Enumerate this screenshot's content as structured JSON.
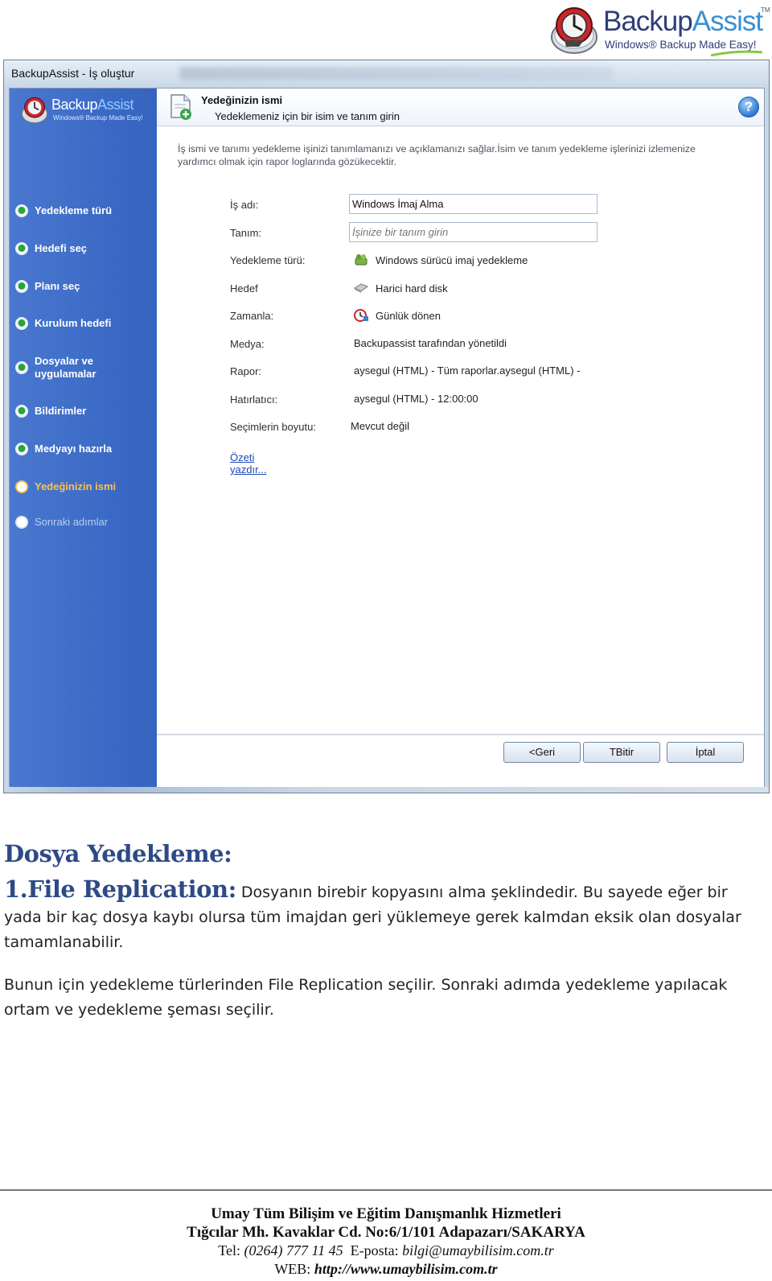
{
  "logo": {
    "brand_part1": "Backup",
    "brand_part2": "Assist",
    "tm": "TM",
    "tagline": "Windows® Backup Made Easy!"
  },
  "window": {
    "title": "BackupAssist - İş oluştur",
    "sidebar_logo": {
      "brand_part1": "Backup",
      "brand_part2": "Assist",
      "tagline": "Windows® Backup Made Easy!"
    },
    "steps": [
      {
        "label": "Yedekleme türü",
        "state": "done"
      },
      {
        "label": "Hedefi seç",
        "state": "done"
      },
      {
        "label": "Planı seç",
        "state": "done"
      },
      {
        "label": "Kurulum hedefi",
        "state": "done"
      },
      {
        "label": "Dosyalar ve uygulamalar",
        "state": "done"
      },
      {
        "label": "Bildirimler",
        "state": "done"
      },
      {
        "label": "Medyayı hazırla",
        "state": "done"
      },
      {
        "label": "Yedeğinizin ismi",
        "state": "current"
      },
      {
        "label": "Sonraki adımlar",
        "state": "future"
      }
    ],
    "header": {
      "title": "Yedeğinizin ismi",
      "subtitle": "Yedeklemeniz için bir isim ve tanım girin",
      "help": "?"
    },
    "intro": "İş ismi ve tanımı yedekleme işinizi tanımlamanızı ve açıklamanızı sağlar.İsim ve tanım yedekleme işlerinizi izlemenize yardımcı olmak için rapor loglarında gözükecektir.",
    "form": {
      "job_name_label": "İş adı:",
      "job_name_value": "Windows İmaj Alma",
      "description_label": "Tanım:",
      "description_placeholder": "İşinize bir tanım girin",
      "backup_type_label": "Yedekleme türü:",
      "backup_type_value": "Windows sürücü imaj yedekleme",
      "target_label": "Hedef",
      "target_value": "Harici hard disk",
      "schedule_label": "Zamanla:",
      "schedule_value": "Günlük dönen",
      "media_label": "Medya:",
      "media_value": "Backupassist tarafından yönetildi",
      "report_label": "Rapor:",
      "report_value": "aysegul (HTML) - Tüm raporlar.aysegul (HTML) -",
      "reminder_label": "Hatırlatıcı:",
      "reminder_value": "aysegul (HTML) - 12:00:00",
      "selection_size_label": "Seçimlerin boyutu:",
      "selection_size_value": "Mevcut değil",
      "print_summary_link": "Özeti yazdır..."
    },
    "buttons": {
      "back": "<Geri",
      "finish": "TBitir",
      "cancel": "İptal"
    }
  },
  "document": {
    "heading": "Dosya Yedekleme:",
    "p1_lead": "1.File Replication:",
    "p1_text": " Dosyanın birebir kopyasını alma şeklindedir. Bu sayede eğer bir yada bir kaç dosya kaybı olursa tüm imajdan geri yüklemeye gerek kalmdan eksik olan dosyalar tamamlanabilir.",
    "p2_text": "Bunun için yedekleme türlerinden File Replication seçilir. Sonraki adımda yedekleme yapılacak ortam ve yedekleme şeması seçilir."
  },
  "footer": {
    "company": "Umay Tüm Bilişim ve Eğitim Danışmanlık Hizmetleri",
    "address": "Tığcılar Mh. Kavaklar Cd. No:6/1/101 Adapazarı/SAKARYA",
    "tel_label": "Tel: ",
    "tel_value": "(0264) 777 11 45",
    "email_label": "  E-posta: ",
    "email_value": "bilgi@umaybilisim.com.tr",
    "web_label": "WEB: ",
    "web_value": "http://www.umaybilisim.com.tr"
  }
}
